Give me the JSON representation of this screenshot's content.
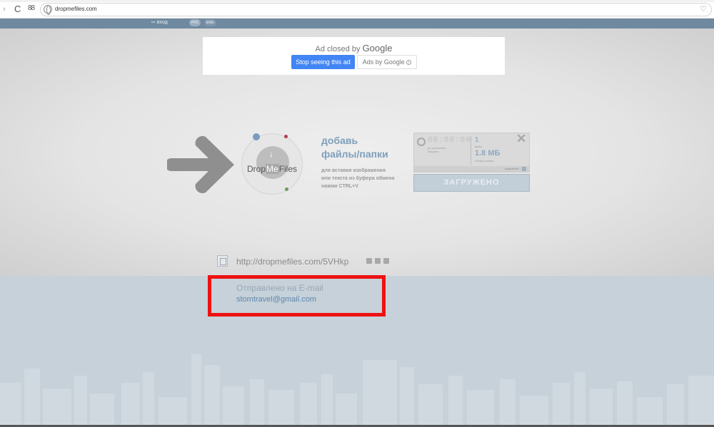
{
  "browser": {
    "url": "dropmefiles.com",
    "nav_forward": "›",
    "nav_reload": "C",
    "nav_tabs": "88",
    "bookmark_icon": "heart-icon"
  },
  "topbar": {
    "login_label": "⇨ вход",
    "lang_ru": "РУС",
    "lang_en": "ENG"
  },
  "ad": {
    "closed_by": "Ad closed by",
    "brand": "Google",
    "stop_button": "Stop seeing this ad",
    "ads_by": "Ads by Google"
  },
  "logo": {
    "text_drop": "Drop",
    "text_me": "Me",
    "text_files": "Files"
  },
  "add": {
    "title_line1": "добавь",
    "title_line2": "файлы/папки",
    "desc_line1": "для вставки изображения",
    "desc_line2": "или текста из буфера обмена",
    "desc_line3": "нажми CTRL+V"
  },
  "upload": {
    "time": "00:00:00",
    "time_sub": "до окончания загрузки",
    "count": "1",
    "count_sub": "файл",
    "size": "1.8 МБ",
    "size_sub": "общий размер",
    "more": "подробнее",
    "button": "ЗАГРУЖЕНО"
  },
  "share": {
    "link": "http://dropmefiles.com/5VHkp"
  },
  "sent": {
    "label": "Отправлено на E-mail",
    "email": "stomtravel@gmail.com"
  },
  "colors": {
    "accent_blue": "#7f9fba",
    "highlight_red": "#ee1111",
    "google_blue": "#4285f4"
  }
}
